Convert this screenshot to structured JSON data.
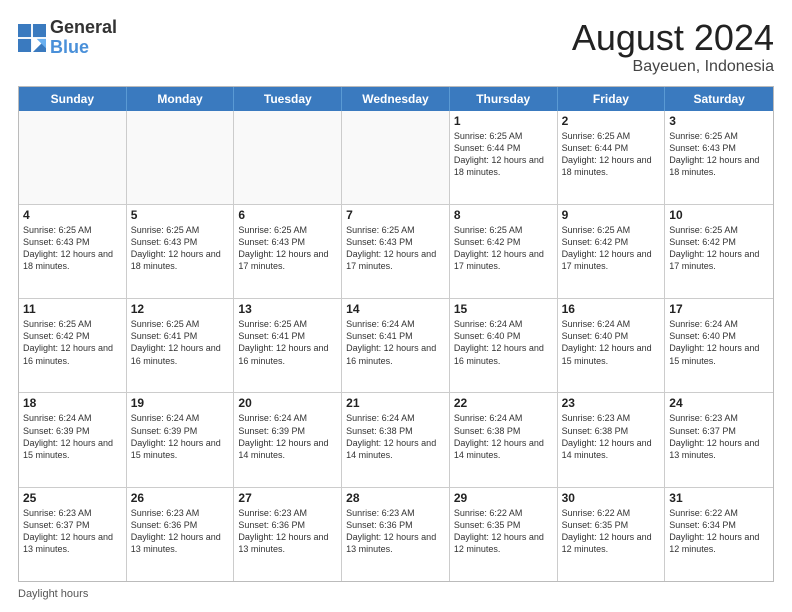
{
  "logo": {
    "line1": "General",
    "line2": "Blue"
  },
  "title": "August 2024",
  "subtitle": "Bayeuen, Indonesia",
  "days_of_week": [
    "Sunday",
    "Monday",
    "Tuesday",
    "Wednesday",
    "Thursday",
    "Friday",
    "Saturday"
  ],
  "weeks": [
    [
      {
        "day": "",
        "empty": true
      },
      {
        "day": "",
        "empty": true
      },
      {
        "day": "",
        "empty": true
      },
      {
        "day": "",
        "empty": true
      },
      {
        "day": "1",
        "rise": "6:25 AM",
        "set": "6:44 PM",
        "hours": "12 hours and 18 minutes."
      },
      {
        "day": "2",
        "rise": "6:25 AM",
        "set": "6:44 PM",
        "hours": "12 hours and 18 minutes."
      },
      {
        "day": "3",
        "rise": "6:25 AM",
        "set": "6:43 PM",
        "hours": "12 hours and 18 minutes."
      }
    ],
    [
      {
        "day": "4",
        "rise": "6:25 AM",
        "set": "6:43 PM",
        "hours": "12 hours and 18 minutes."
      },
      {
        "day": "5",
        "rise": "6:25 AM",
        "set": "6:43 PM",
        "hours": "12 hours and 18 minutes."
      },
      {
        "day": "6",
        "rise": "6:25 AM",
        "set": "6:43 PM",
        "hours": "12 hours and 17 minutes."
      },
      {
        "day": "7",
        "rise": "6:25 AM",
        "set": "6:43 PM",
        "hours": "12 hours and 17 minutes."
      },
      {
        "day": "8",
        "rise": "6:25 AM",
        "set": "6:42 PM",
        "hours": "12 hours and 17 minutes."
      },
      {
        "day": "9",
        "rise": "6:25 AM",
        "set": "6:42 PM",
        "hours": "12 hours and 17 minutes."
      },
      {
        "day": "10",
        "rise": "6:25 AM",
        "set": "6:42 PM",
        "hours": "12 hours and 17 minutes."
      }
    ],
    [
      {
        "day": "11",
        "rise": "6:25 AM",
        "set": "6:42 PM",
        "hours": "12 hours and 16 minutes."
      },
      {
        "day": "12",
        "rise": "6:25 AM",
        "set": "6:41 PM",
        "hours": "12 hours and 16 minutes."
      },
      {
        "day": "13",
        "rise": "6:25 AM",
        "set": "6:41 PM",
        "hours": "12 hours and 16 minutes."
      },
      {
        "day": "14",
        "rise": "6:24 AM",
        "set": "6:41 PM",
        "hours": "12 hours and 16 minutes."
      },
      {
        "day": "15",
        "rise": "6:24 AM",
        "set": "6:40 PM",
        "hours": "12 hours and 16 minutes."
      },
      {
        "day": "16",
        "rise": "6:24 AM",
        "set": "6:40 PM",
        "hours": "12 hours and 15 minutes."
      },
      {
        "day": "17",
        "rise": "6:24 AM",
        "set": "6:40 PM",
        "hours": "12 hours and 15 minutes."
      }
    ],
    [
      {
        "day": "18",
        "rise": "6:24 AM",
        "set": "6:39 PM",
        "hours": "12 hours and 15 minutes."
      },
      {
        "day": "19",
        "rise": "6:24 AM",
        "set": "6:39 PM",
        "hours": "12 hours and 15 minutes."
      },
      {
        "day": "20",
        "rise": "6:24 AM",
        "set": "6:39 PM",
        "hours": "12 hours and 14 minutes."
      },
      {
        "day": "21",
        "rise": "6:24 AM",
        "set": "6:38 PM",
        "hours": "12 hours and 14 minutes."
      },
      {
        "day": "22",
        "rise": "6:24 AM",
        "set": "6:38 PM",
        "hours": "12 hours and 14 minutes."
      },
      {
        "day": "23",
        "rise": "6:23 AM",
        "set": "6:38 PM",
        "hours": "12 hours and 14 minutes."
      },
      {
        "day": "24",
        "rise": "6:23 AM",
        "set": "6:37 PM",
        "hours": "12 hours and 13 minutes."
      }
    ],
    [
      {
        "day": "25",
        "rise": "6:23 AM",
        "set": "6:37 PM",
        "hours": "12 hours and 13 minutes."
      },
      {
        "day": "26",
        "rise": "6:23 AM",
        "set": "6:36 PM",
        "hours": "12 hours and 13 minutes."
      },
      {
        "day": "27",
        "rise": "6:23 AM",
        "set": "6:36 PM",
        "hours": "12 hours and 13 minutes."
      },
      {
        "day": "28",
        "rise": "6:23 AM",
        "set": "6:36 PM",
        "hours": "12 hours and 13 minutes."
      },
      {
        "day": "29",
        "rise": "6:22 AM",
        "set": "6:35 PM",
        "hours": "12 hours and 12 minutes."
      },
      {
        "day": "30",
        "rise": "6:22 AM",
        "set": "6:35 PM",
        "hours": "12 hours and 12 minutes."
      },
      {
        "day": "31",
        "rise": "6:22 AM",
        "set": "6:34 PM",
        "hours": "12 hours and 12 minutes."
      }
    ]
  ],
  "footer": "Daylight hours"
}
